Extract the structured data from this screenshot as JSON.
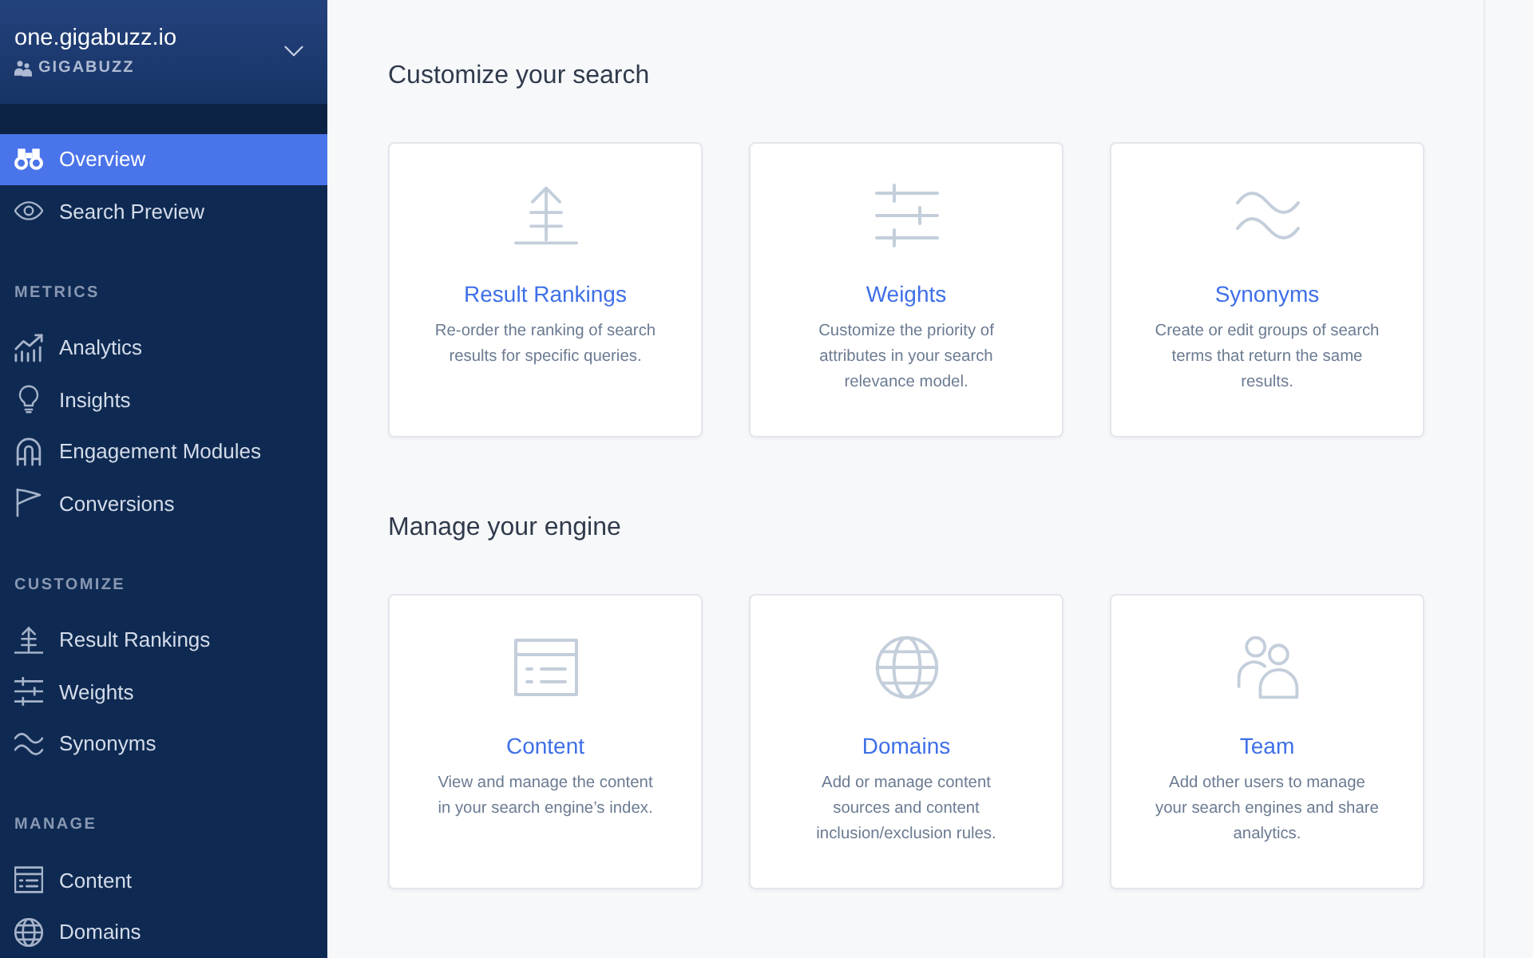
{
  "sidebar": {
    "account": {
      "domain": "one.gigabuzz.io",
      "organization": "GIGABUZZ"
    },
    "items": [
      {
        "label": "Overview",
        "selected": true
      },
      {
        "label": "Search Preview",
        "selected": false
      }
    ],
    "sections": [
      {
        "title": "METRICS",
        "items": [
          {
            "label": "Analytics",
            "selected": false
          },
          {
            "label": "Insights",
            "selected": false
          },
          {
            "label": "Engagement Modules",
            "selected": false
          },
          {
            "label": "Conversions",
            "selected": false
          }
        ]
      },
      {
        "title": "CUSTOMIZE",
        "items": [
          {
            "label": "Result Rankings",
            "selected": false
          },
          {
            "label": "Weights",
            "selected": false
          },
          {
            "label": "Synonyms",
            "selected": false
          }
        ]
      },
      {
        "title": "MANAGE",
        "items": [
          {
            "label": "Content",
            "selected": false
          },
          {
            "label": "Domains",
            "selected": false
          }
        ]
      }
    ]
  },
  "main": {
    "sections": [
      {
        "title": "Customize your search",
        "cards": [
          {
            "title": "Result Rankings",
            "description": "Re-order the ranking of search results for specific queries."
          },
          {
            "title": "Weights",
            "description": "Customize the priority of attributes in your search relevance model."
          },
          {
            "title": "Synonyms",
            "description": "Create or edit groups of search terms that return the same results."
          }
        ]
      },
      {
        "title": "Manage your engine",
        "cards": [
          {
            "title": "Content",
            "description": "View and manage the content in your search engine’s index."
          },
          {
            "title": "Domains",
            "description": "Add or manage content sources and content inclusion/exclusion rules."
          },
          {
            "title": "Team",
            "description": "Add other users to manage your search engines and share analytics."
          }
        ]
      }
    ]
  }
}
